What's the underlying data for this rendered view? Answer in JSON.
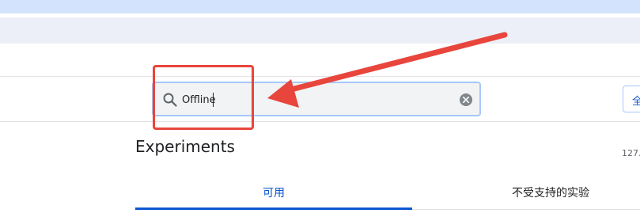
{
  "search": {
    "value": "Offline",
    "icon": "search-icon",
    "clear_icon": "clear-icon"
  },
  "header": {
    "reset_label": "全"
  },
  "main": {
    "title": "Experiments",
    "version": "127."
  },
  "tabs": [
    {
      "label": "可用",
      "active": true
    },
    {
      "label": "不受支持的实验",
      "active": false
    }
  ],
  "colors": {
    "accent": "#0b57d0",
    "annotation": "#e8453c",
    "search_border": "#a8c7fa"
  }
}
